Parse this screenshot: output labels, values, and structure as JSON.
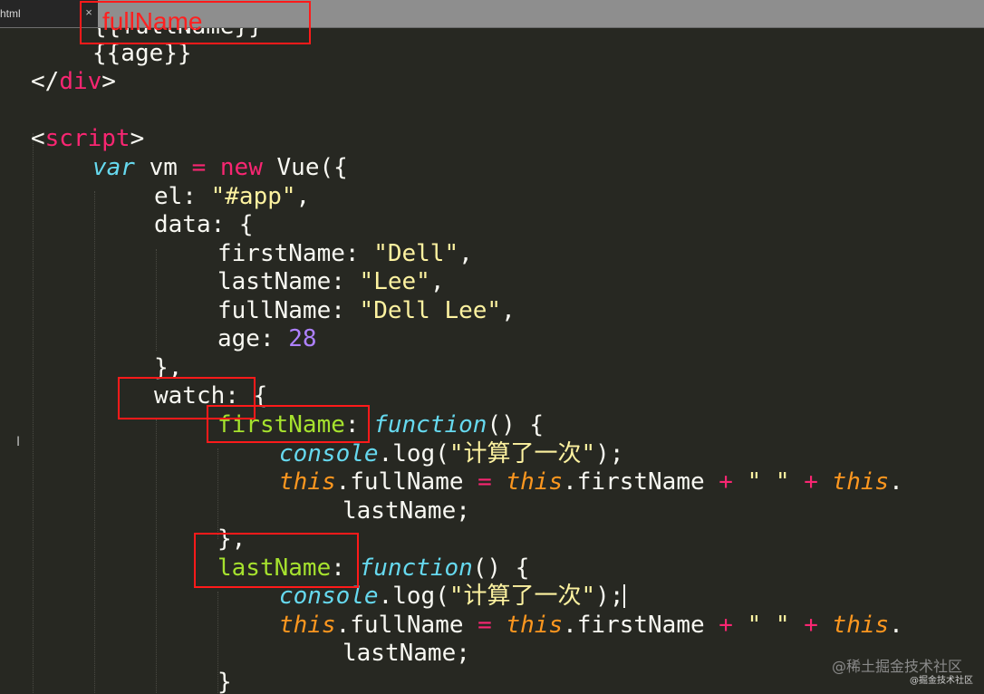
{
  "tab": {
    "label": "html",
    "close_glyph": "×"
  },
  "annotation": {
    "title": "fullName"
  },
  "code": {
    "l1": {
      "text": "{{fullName}}"
    },
    "l2": {
      "text": "{{age}}"
    },
    "l3": {
      "open": "</",
      "tag": "div",
      "close": ">"
    },
    "l4": {
      "open": "<",
      "tag": "script",
      "close": ">"
    },
    "l5": {
      "var": "var",
      "name": " vm ",
      "eq": "=",
      "sp": " ",
      "new": "new",
      "rest": " Vue({"
    },
    "l6": {
      "key": "el: ",
      "str": "\"#app\"",
      "end": ","
    },
    "l7": {
      "text": "data: {"
    },
    "l8": {
      "key": "firstName: ",
      "str": "\"Dell\"",
      "end": ","
    },
    "l9": {
      "key": "lastName: ",
      "str": "\"Lee\"",
      "end": ","
    },
    "l10": {
      "key": "fullName: ",
      "str": "\"Dell Lee\"",
      "end": ","
    },
    "l11": {
      "key": "age: ",
      "num": "28"
    },
    "l12": {
      "text": "},"
    },
    "l13": {
      "text": "watch: {"
    },
    "l14": {
      "key": "firstName",
      "colon": ": ",
      "fn": "function",
      "rest": "() {"
    },
    "l15": {
      "obj": "console",
      "dot": ".",
      "method": "log(",
      "str": "\"计算了一次\"",
      "end": ");"
    },
    "l16": {
      "this1": "this",
      "mid1": ".fullName ",
      "eq": "=",
      "sp1": " ",
      "this2": "this",
      "mid2": ".firstName ",
      "plus1": "+",
      "sp2": " ",
      "str": "\" \"",
      "sp3": " ",
      "plus2": "+",
      "sp4": " ",
      "this3": "this",
      "end": "."
    },
    "l17": {
      "text": "lastName;"
    },
    "l18": {
      "text": "},"
    },
    "l19": {
      "key": "lastName",
      "colon": ": ",
      "fn": "function",
      "rest": "() {"
    },
    "l20": {
      "obj": "console",
      "dot": ".",
      "method": "log(",
      "str": "\"计算了一次\"",
      "end": ");"
    },
    "l21": {
      "this1": "this",
      "mid1": ".fullName ",
      "eq": "=",
      "sp1": " ",
      "this2": "this",
      "mid2": ".firstName ",
      "plus1": "+",
      "sp2": " ",
      "str": "\" \"",
      "sp3": " ",
      "plus2": "+",
      "sp4": " ",
      "this3": "this",
      "end": "."
    },
    "l22": {
      "text": "lastName;"
    },
    "l23": {
      "text": "}"
    }
  },
  "watermark": {
    "site": "@稀土掘金技术社区",
    "small": "@掘金技术社区"
  },
  "colors": {
    "background": "#272822",
    "keyword": "#f92672",
    "string": "#fdf2a0",
    "number": "#ae81ff",
    "function_name": "#a6e22e",
    "storage": "#66d9ef",
    "this": "#fd971f",
    "annotation": "#ff1a1a"
  }
}
